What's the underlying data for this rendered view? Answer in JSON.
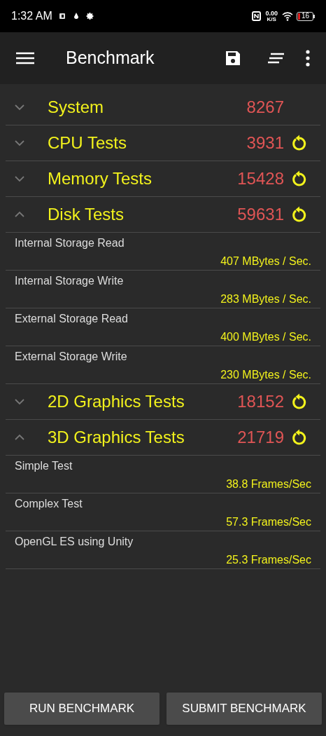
{
  "status_bar": {
    "time": "1:32 AM",
    "network_speed": "0.00",
    "network_unit": "K/S",
    "battery": "16"
  },
  "toolbar": {
    "title": "Benchmark"
  },
  "groups": [
    {
      "name": "System",
      "score": "8267",
      "expanded": false,
      "rerun": false
    },
    {
      "name": "CPU Tests",
      "score": "3931",
      "expanded": false,
      "rerun": true
    },
    {
      "name": "Memory Tests",
      "score": "15428",
      "expanded": false,
      "rerun": true
    },
    {
      "name": "Disk Tests",
      "score": "59631",
      "expanded": true,
      "rerun": true,
      "results": [
        {
          "name": "Internal Storage Read",
          "value": "407 MBytes / Sec."
        },
        {
          "name": "Internal Storage Write",
          "value": "283 MBytes / Sec."
        },
        {
          "name": "External Storage Read",
          "value": "400 MBytes / Sec."
        },
        {
          "name": "External Storage Write",
          "value": "230 MBytes / Sec."
        }
      ]
    },
    {
      "name": "2D Graphics Tests",
      "score": "18152",
      "expanded": false,
      "rerun": true
    },
    {
      "name": "3D Graphics Tests",
      "score": "21719",
      "expanded": true,
      "rerun": true,
      "results": [
        {
          "name": "Simple Test",
          "value": "38.8 Frames/Sec"
        },
        {
          "name": "Complex Test",
          "value": "57.3 Frames/Sec"
        },
        {
          "name": "OpenGL ES using Unity",
          "value": "25.3 Frames/Sec"
        }
      ]
    }
  ],
  "buttons": [
    "RUN BENCHMARK",
    "SUBMIT BENCHMARK"
  ]
}
